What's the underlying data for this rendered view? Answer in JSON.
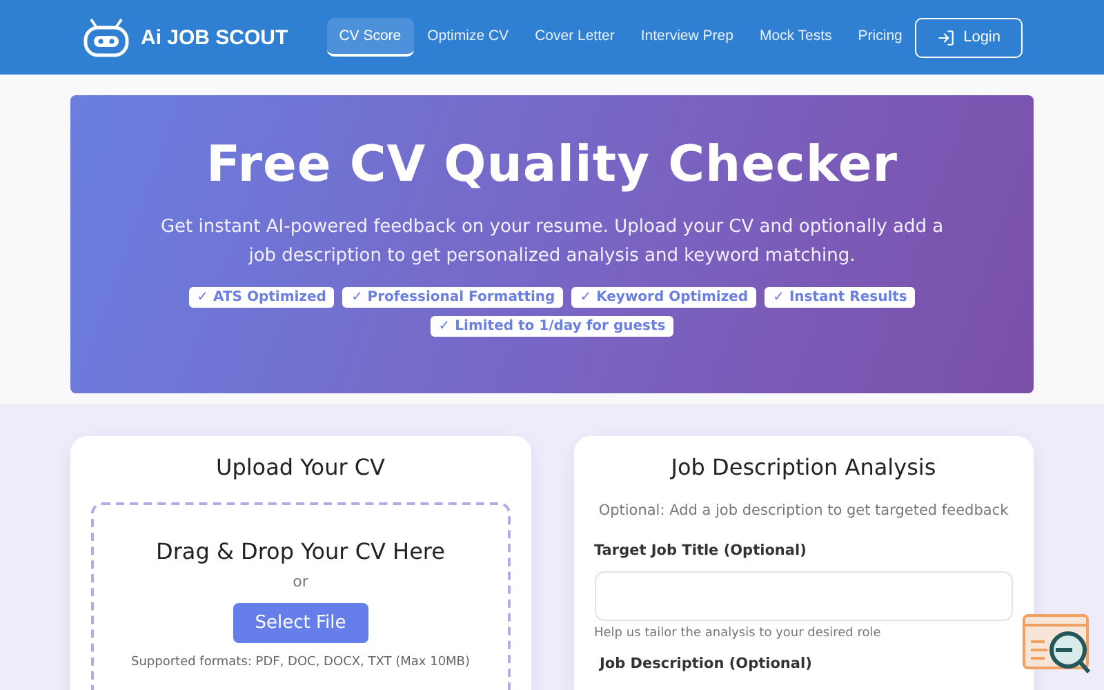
{
  "brand": {
    "name": "Ai JOB SCOUT"
  },
  "nav": [
    {
      "label": "CV Score",
      "selected": true
    },
    {
      "label": "Optimize CV",
      "selected": false
    },
    {
      "label": "Cover Letter",
      "selected": false
    },
    {
      "label": "Interview Prep",
      "selected": false
    },
    {
      "label": "Mock Tests",
      "selected": false
    },
    {
      "label": "Pricing",
      "selected": false
    }
  ],
  "login": {
    "label": "Login"
  },
  "hero": {
    "title": "Free CV Quality Checker",
    "subtitle": "Get instant AI-powered feedback on your resume. Upload your CV and optionally add a job description to get personalized analysis and keyword matching.",
    "badges": [
      "✓ ATS Optimized",
      "✓ Professional Formatting",
      "✓ Keyword Optimized",
      "✓ Instant Results",
      "✓ Limited to 1/day for guests"
    ]
  },
  "upload": {
    "title": "Upload Your CV",
    "drop_title": "Drag & Drop Your CV Here",
    "or": "or",
    "button": "Select File",
    "formats": "Supported formats: PDF, DOC, DOCX, TXT (Max 10MB)"
  },
  "job": {
    "title": "Job Description Analysis",
    "intro": "Optional: Add a job description to get targeted feedback",
    "title_label": "Target Job Title (Optional)",
    "title_help": "Help us tailor the analysis to your desired role",
    "desc_label": "Job Description (Optional)"
  }
}
